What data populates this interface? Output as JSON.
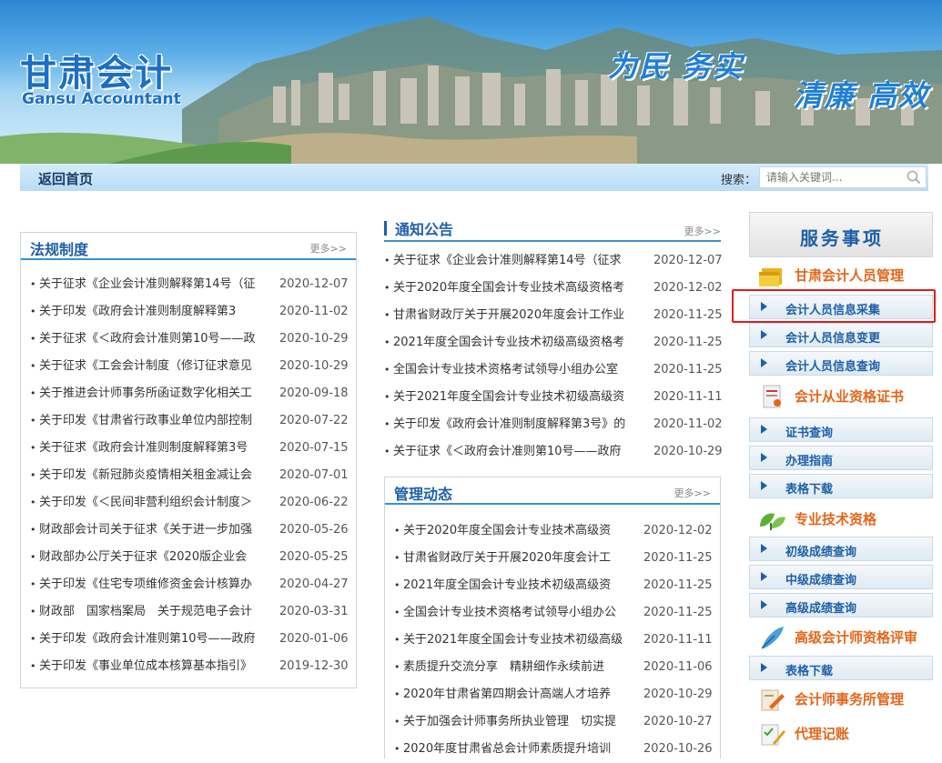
{
  "banner": {
    "logo_cn": "甘肃会计",
    "logo_en": "Gansu Accountant",
    "slogan1": "为民 务实",
    "slogan2": "清廉 高效"
  },
  "nav": {
    "home": "返回首页",
    "search_label": "搜索：",
    "search_placeholder": "请输入关键词..."
  },
  "regulations": {
    "title": "法规制度",
    "more": "更多>>",
    "items": [
      {
        "t": "关于征求《企业会计准则解释第14号（征",
        "d": "2020-12-07"
      },
      {
        "t": "关于印发《政府会计准则制度解释第3",
        "d": "2020-11-02"
      },
      {
        "t": "关于征求《＜政府会计准则第10号——政",
        "d": "2020-10-29"
      },
      {
        "t": "关于征求《工会会计制度（修订征求意见",
        "d": "2020-10-29"
      },
      {
        "t": "关于推进会计师事务所函证数字化相关工",
        "d": "2020-09-18"
      },
      {
        "t": "关于印发《甘肃省行政事业单位内部控制",
        "d": "2020-07-22"
      },
      {
        "t": "关于征求《政府会计准则制度解释第3号",
        "d": "2020-07-15"
      },
      {
        "t": "关于印发《新冠肺炎疫情相关租金减让会",
        "d": "2020-07-01"
      },
      {
        "t": "关于印发《＜民间非营利组织会计制度＞",
        "d": "2020-06-22"
      },
      {
        "t": "财政部会计司关于征求《关于进一步加强",
        "d": "2020-05-26"
      },
      {
        "t": "财政部办公厅关于征求《2020版企业会",
        "d": "2020-05-25"
      },
      {
        "t": "关于印发《住宅专项维修资金会计核算办",
        "d": "2020-04-27"
      },
      {
        "t": "财政部　国家档案局　关于规范电子会计",
        "d": "2020-03-31"
      },
      {
        "t": "关于印发《政府会计准则第10号——政府",
        "d": "2020-01-06"
      },
      {
        "t": "关于印发《事业单位成本核算基本指引》",
        "d": "2019-12-30"
      }
    ]
  },
  "notices": {
    "title": "通知公告",
    "more": "更多>>",
    "items": [
      {
        "t": "关于征求《企业会计准则解释第14号（征求",
        "d": "2020-12-07"
      },
      {
        "t": "关于2020年度全国会计专业技术高级资格考",
        "d": "2020-12-02"
      },
      {
        "t": "甘肃省财政厅关于开展2020年度会计工作业",
        "d": "2020-11-25"
      },
      {
        "t": "2021年度全国会计专业技术初级高级资格考",
        "d": "2020-11-25"
      },
      {
        "t": "全国会计专业技术资格考试领导小组办公室",
        "d": "2020-11-25"
      },
      {
        "t": "关于2021年度全国会计专业技术初级高级资",
        "d": "2020-11-11"
      },
      {
        "t": "关于印发《政府会计准则制度解释第3号》的",
        "d": "2020-11-02"
      },
      {
        "t": "关于征求《＜政府会计准则第10号——政府",
        "d": "2020-10-29"
      }
    ]
  },
  "management": {
    "title": "管理动态",
    "more": "更多>>",
    "items": [
      {
        "t": "关于2020年度全国会计专业技术高级资",
        "d": "2020-12-02"
      },
      {
        "t": "甘肃省财政厅关于开展2020年度会计工",
        "d": "2020-11-25"
      },
      {
        "t": "2021年度全国会计专业技术初级高级资",
        "d": "2020-11-25"
      },
      {
        "t": "全国会计专业技术资格考试领导小组办公",
        "d": "2020-11-25"
      },
      {
        "t": "关于2021年度全国会计专业技术初级高级",
        "d": "2020-11-11"
      },
      {
        "t": "素质提升交流分享　精耕细作永续前进",
        "d": "2020-11-06"
      },
      {
        "t": "2020年甘肃省第四期会计高端人才培养",
        "d": "2020-10-29"
      },
      {
        "t": "关于加强会计师事务所执业管理　切实提",
        "d": "2020-10-27"
      },
      {
        "t": "2020年度甘肃省总会计师素质提升培训",
        "d": "2020-10-26"
      }
    ]
  },
  "services": {
    "title": "服务事项",
    "cat1": "甘肃会计人员管理",
    "cat1_items": [
      "会计人员信息采集",
      "会计人员信息变更",
      "会计人员信息查询"
    ],
    "cat2": "会计从业资格证书",
    "cat2_items": [
      "证书查询",
      "办理指南",
      "表格下载"
    ],
    "cat3": "专业技术资格",
    "cat3_items": [
      "初级成绩查询",
      "中级成绩查询",
      "高级成绩查询"
    ],
    "cat4": "高级会计师资格评审",
    "cat4_items": [
      "表格下载"
    ],
    "cat5": "会计师事务所管理",
    "cat6": "代理记账"
  },
  "colors": {
    "accent": "#1e5fa8",
    "orange": "#e2661a",
    "highlight": "#e21c1c"
  }
}
